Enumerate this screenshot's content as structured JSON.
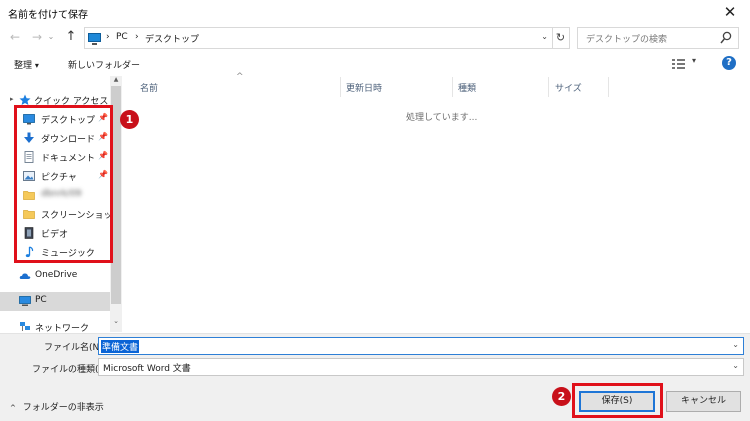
{
  "window": {
    "title": "名前を付けて保存",
    "close_symbol": "✕"
  },
  "address": {
    "back_symbol": "←",
    "forward_symbol": "→",
    "up_symbol": "↑",
    "separator": "›",
    "crumbs": [
      "PC",
      "デスクトップ"
    ],
    "dropdown_symbol": "⌄",
    "refresh_symbol": "↻"
  },
  "search": {
    "placeholder": "デスクトップの検索"
  },
  "toolbar": {
    "organize_label": "整理",
    "organize_arrow": "▾",
    "new_folder_label": "新しいフォルダー",
    "view_dropdown": "▾",
    "help_symbol": "?"
  },
  "nav": {
    "quick_access": "クイック アクセス",
    "quick_chevron": "▸",
    "pin_symbol": "📌",
    "items": [
      {
        "label": "デスクトップ",
        "icon": "desktop-icon",
        "pinned": true
      },
      {
        "label": "ダウンロード",
        "icon": "download-icon",
        "pinned": true
      },
      {
        "label": "ドキュメント",
        "icon": "document-icon",
        "pinned": true
      },
      {
        "label": "ピクチャ",
        "icon": "picture-icon",
        "pinned": true
      },
      {
        "label": "dbnrk/09",
        "icon": "folder-icon",
        "pinned": false
      },
      {
        "label": "スクリーンショット",
        "icon": "folder-icon",
        "pinned": false
      },
      {
        "label": "ビデオ",
        "icon": "video-icon",
        "pinned": false
      },
      {
        "label": "ミュージック",
        "icon": "music-icon",
        "pinned": false
      }
    ],
    "onedrive": "OneDrive",
    "pc": "PC",
    "network": "ネットワーク",
    "scroll_up": "▲",
    "scroll_down": "⌄"
  },
  "badges": {
    "one": "1",
    "two": "2"
  },
  "file_list": {
    "sort_caret": "^",
    "columns": [
      "名前",
      "更新日時",
      "種類",
      "サイズ"
    ],
    "status": "処理しています..."
  },
  "save_form": {
    "filename_label": "ファイル名(N):",
    "filename_value": "準備文書",
    "filetype_label": "ファイルの種類(T):",
    "filetype_value": "Microsoft Word 文書",
    "dropdown_symbol": "⌄"
  },
  "footer": {
    "hide_folders_chevron": "^",
    "hide_folders_label": "フォルダーの非表示",
    "save_label": "保存(S)",
    "cancel_label": "キャンセル"
  },
  "colors": {
    "highlight_red": "#e0101a",
    "badge_red": "#c8101a",
    "accent_blue": "#1e75d6",
    "selection_blue": "#0a64d6"
  }
}
